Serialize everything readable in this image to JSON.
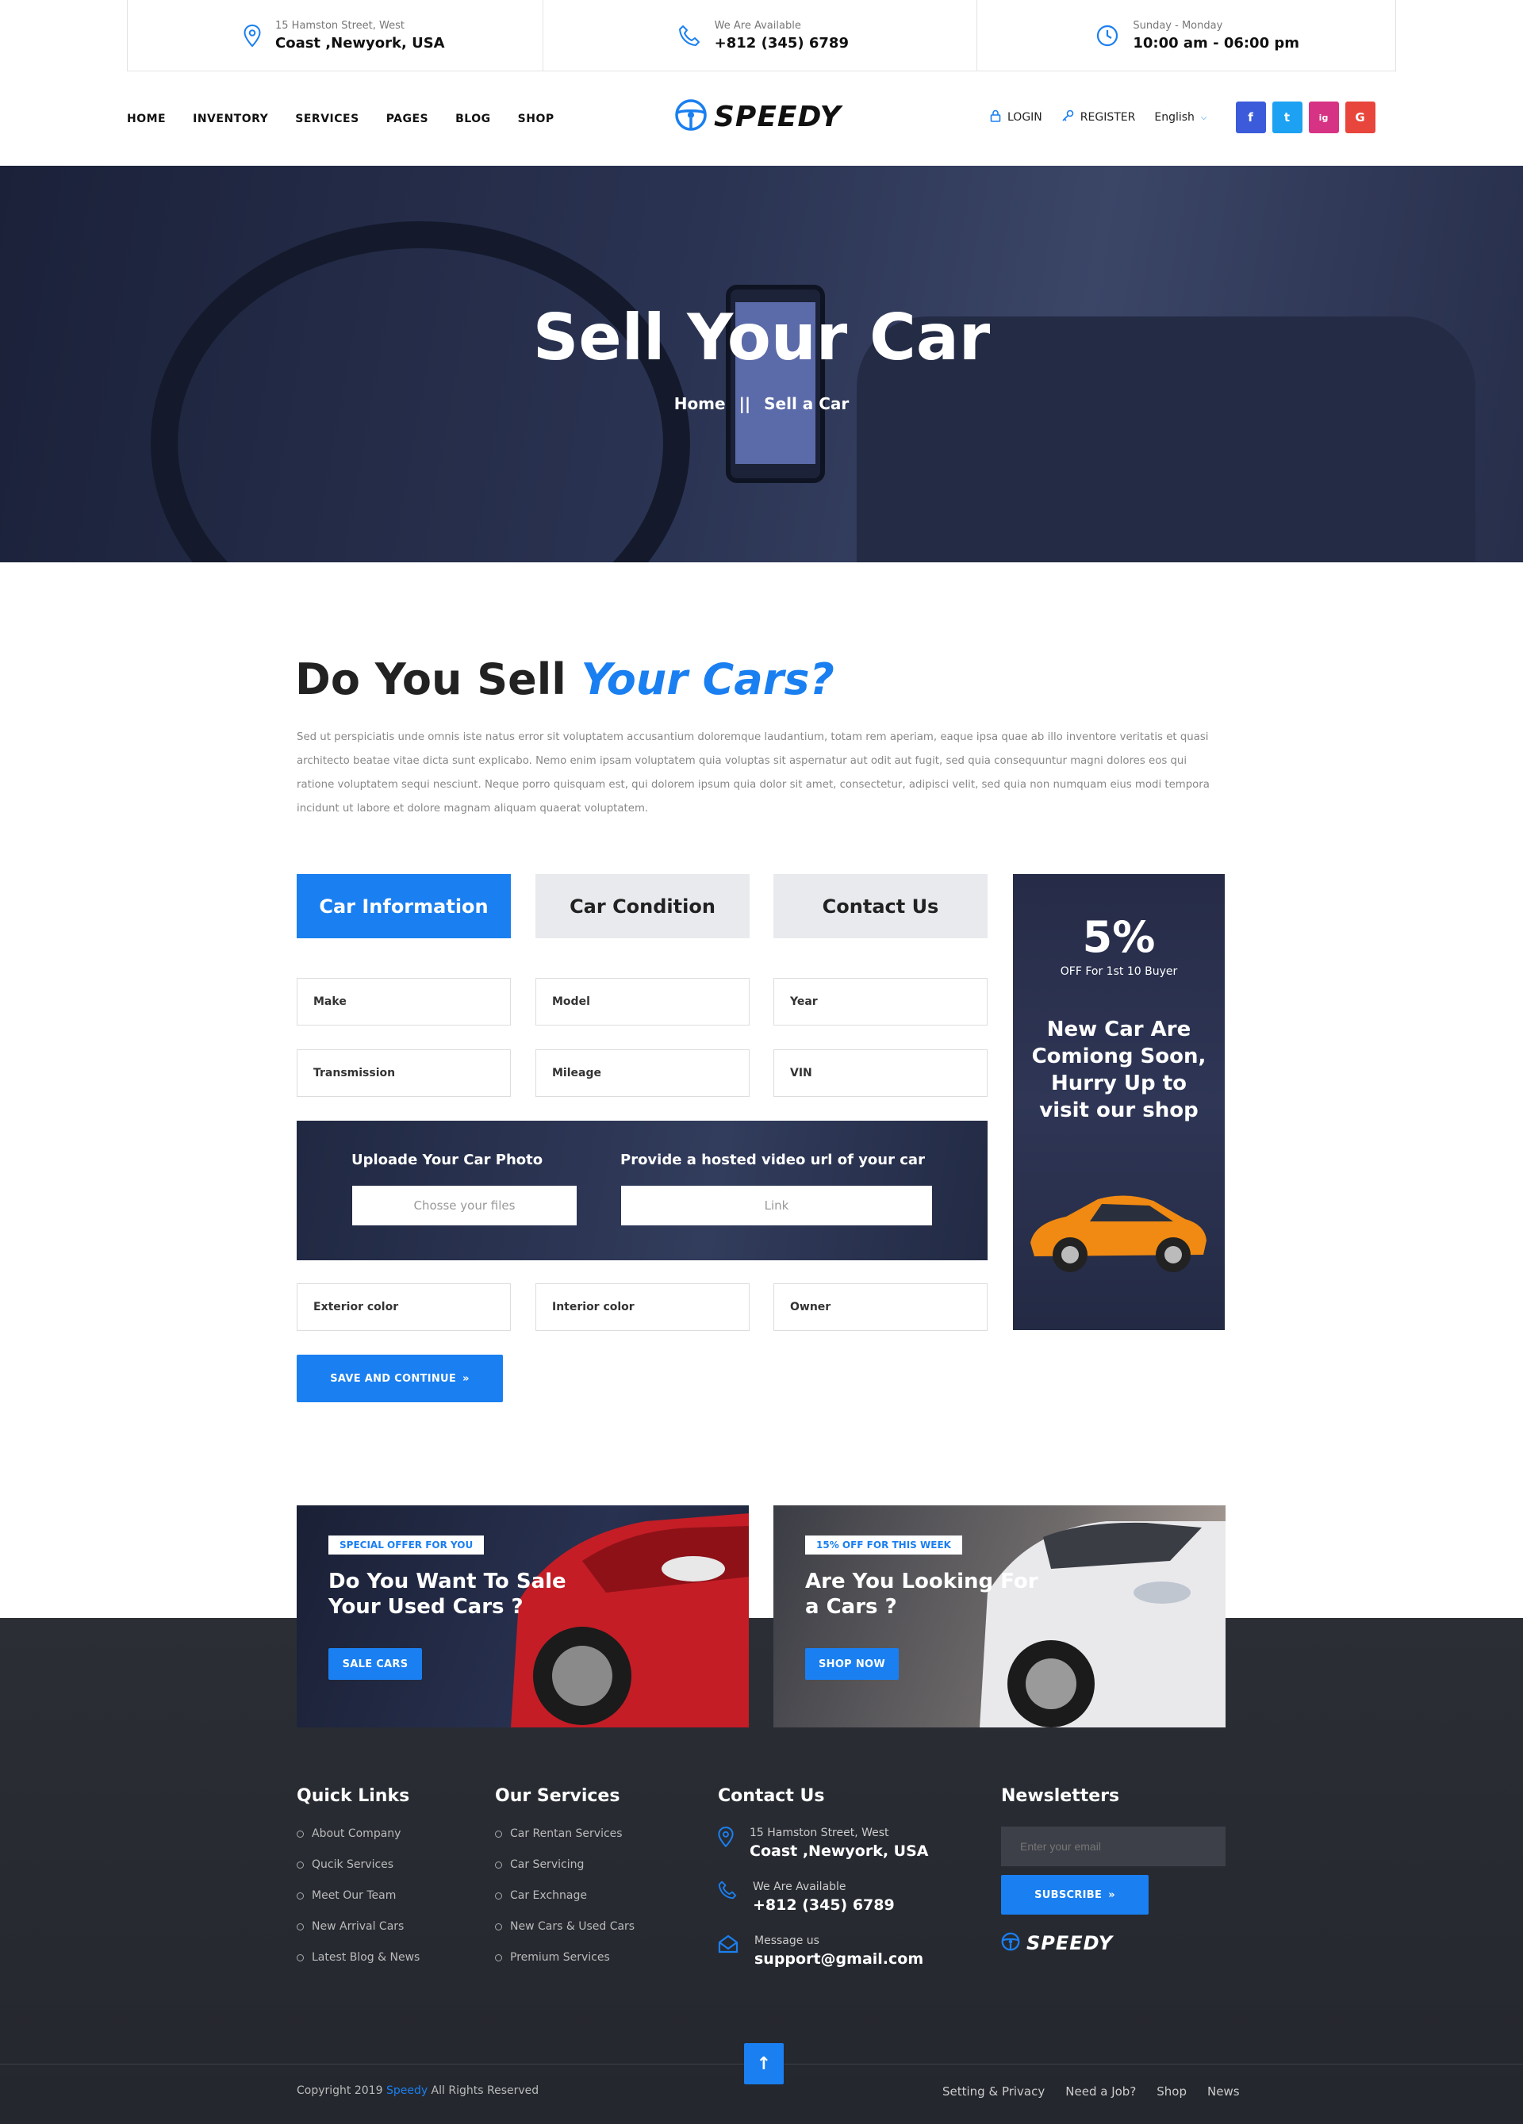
{
  "topbar": {
    "address_small": "15 Hamston Street, West",
    "address_large": "Coast ,Newyork, USA",
    "phone_small": "We Are Available",
    "phone_large": "+812 (345) 6789",
    "hours_small": "Sunday - Monday",
    "hours_large": "10:00 am - 06:00 pm"
  },
  "nav": {
    "items": [
      "HOME",
      "INVENTORY",
      "SERVICES",
      "PAGES",
      "BLOG",
      "SHOP"
    ],
    "logo": "SPEEDY",
    "login": "LOGIN",
    "register": "REGISTER",
    "language": "English",
    "social": [
      "f",
      "t",
      "ig",
      "G"
    ]
  },
  "hero": {
    "title": "Sell Your Car",
    "crumb_home": "Home",
    "crumb_sep": "||",
    "crumb_current": "Sell a Car"
  },
  "intro": {
    "title_plain": "Do You Sell ",
    "title_accent": "Your Cars?",
    "text": "Sed ut perspiciatis unde omnis iste natus error sit voluptatem accusantium doloremque laudantium, totam rem aperiam, eaque ipsa quae ab illo inventore veritatis et quasi architecto beatae vitae dicta sunt explicabo. Nemo enim ipsam voluptatem quia voluptas sit aspernatur aut odit aut fugit, sed quia consequuntur magni dolores eos qui ratione voluptatem sequi nesciunt. Neque porro quisquam est, qui dolorem ipsum quia dolor sit amet, consectetur, adipisci velit, sed quia non numquam eius modi tempora incidunt ut labore et dolore magnam aliquam quaerat voluptatem."
  },
  "tabs": [
    "Car Information",
    "Car Condition",
    "Contact Us"
  ],
  "fields": {
    "row1": [
      "Make",
      "Model",
      "Year"
    ],
    "row2": [
      "Transmission",
      "Mileage",
      "VIN"
    ],
    "row3": [
      "Exterior color",
      "Interior color",
      "Owner"
    ]
  },
  "upload": {
    "photo_label": "Uploade Your Car Photo",
    "photo_placeholder": "Chosse your files",
    "video_label": "Provide a hosted video url of your car",
    "video_placeholder": "Link"
  },
  "save_button": "SAVE AND CONTINUE",
  "promo": {
    "percent": "5%",
    "sub": "OFF For 1st 10 Buyer",
    "headline": "New Car Are Comiong Soon, Hurry Up to visit our shop"
  },
  "cards": [
    {
      "tag": "SPECIAL OFFER FOR YOU",
      "title": "Do You Want To Sale Your Used Cars ?",
      "button": "SALE CARS"
    },
    {
      "tag": "15% OFF FOR THIS WEEK",
      "title": "Are You Looking For a Cars ?",
      "button": "SHOP NOW"
    }
  ],
  "footer": {
    "quick_links_title": "Quick Links",
    "quick_links": [
      "About Company",
      "Qucik Services",
      "Meet Our Team",
      "New Arrival Cars",
      "Latest Blog & News"
    ],
    "services_title": "Our Services",
    "services": [
      "Car Rentan Services",
      "Car Servicing",
      "Car Exchnage",
      "New Cars & Used Cars",
      "Premium Services"
    ],
    "contact_title": "Contact Us",
    "contact": [
      {
        "small": "15 Hamston Street, West",
        "large": "Coast ,Newyork, USA"
      },
      {
        "small": "We Are Available",
        "large": "+812 (345) 6789"
      },
      {
        "small": "Message us",
        "large": "support@gmail.com"
      }
    ],
    "newsletter_title": "Newsletters",
    "email_placeholder": "Enter your email",
    "subscribe": "SUBSCRIBE",
    "logo": "SPEEDY",
    "copyright_pre": "Copyright  2019 ",
    "copyright_brand": "Speedy",
    "copyright_post": " All Rights Reserved",
    "bottom_links": [
      "Setting & Privacy",
      "Need a Job?",
      "Shop",
      "News"
    ],
    "to_top": "↑"
  },
  "colors": {
    "accent": "#1a7ff0",
    "dark": "#262c47",
    "facebook": "#3b5bdb",
    "twitter": "#1da1f2",
    "instagram": "#d63384",
    "google": "#e8453c"
  }
}
